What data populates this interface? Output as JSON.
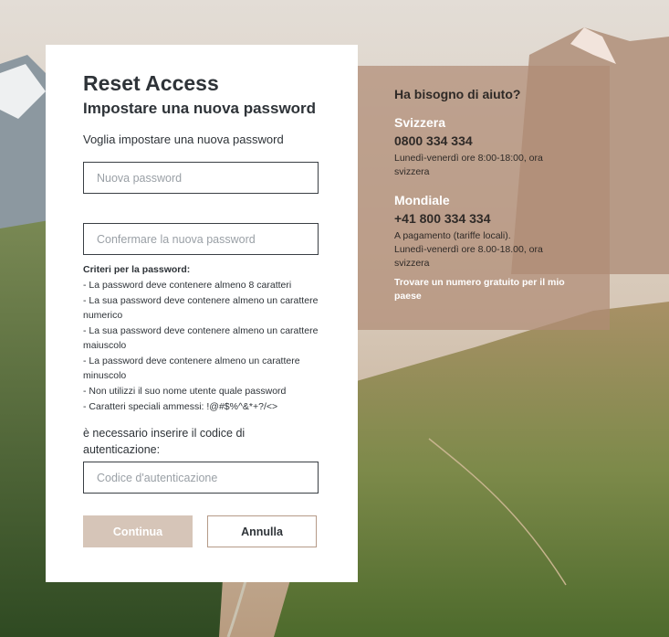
{
  "background_colors": {
    "sky": "#d9d2c9",
    "valley": "#56703a",
    "snow": "#f4efe8"
  },
  "card": {
    "brand": "Reset Access",
    "subtitle": "Impostare una nuova password",
    "lead": "Voglia impostare una nuova password",
    "new_password": {
      "placeholder": "Nuova password",
      "value": ""
    },
    "confirm_password": {
      "placeholder": "Confermare la nuova password",
      "value": ""
    },
    "criteria_title": "Criteri per la password:",
    "criteria": [
      "- La password deve contenere almeno 8 caratteri",
      "- La sua password deve contenere almeno un carattere numerico",
      "- La sua password deve contenere almeno un carattere maiuscolo",
      "- La password deve contenere almeno un carattere minuscolo",
      "- Non utilizzi il suo nome utente quale password",
      "- Caratteri speciali ammessi: !@#$%^&*+?/<>"
    ],
    "auth_label": "è necessario inserire il codice di autenticazione:",
    "auth_code": {
      "placeholder": "Codice d'autenticazione",
      "value": ""
    },
    "continue_label": "Continua",
    "cancel_label": "Annulla"
  },
  "help": {
    "title": "Ha bisogno di aiuto?",
    "switzerland": {
      "region": "Svizzera",
      "phone": "0800 334 334",
      "hours": "Lunedì-venerdì ore 8:00-18:00, ora svizzera"
    },
    "worldwide": {
      "region": "Mondiale",
      "phone": "+41 800 334 334",
      "fees": "A pagamento (tariffe locali).",
      "hours": "Lunedì-venerdì ore 8.00-18.00, ora svizzera"
    },
    "link": "Trovare un numero gratuito per il mio paese"
  }
}
